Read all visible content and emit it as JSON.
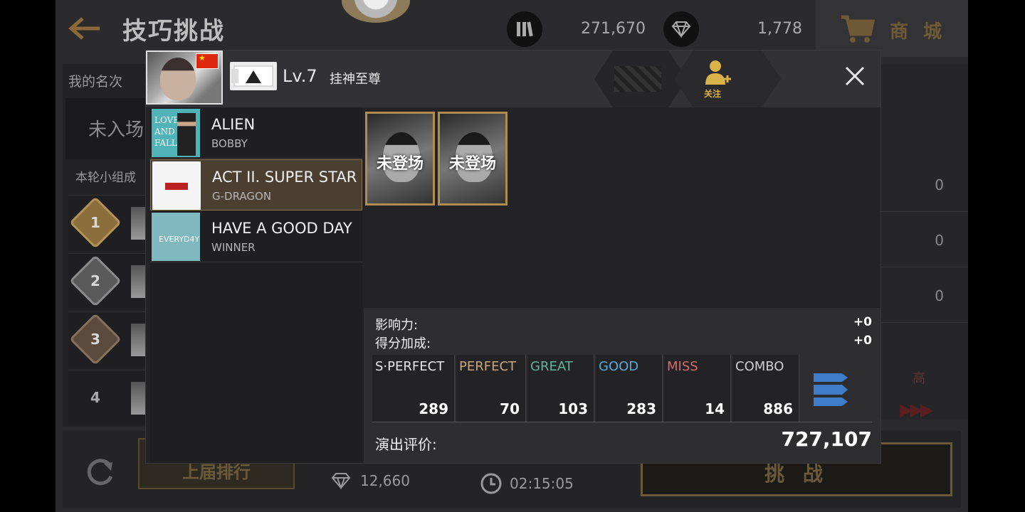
{
  "header": {
    "title": "技巧挑战",
    "currency1_value": "271,670",
    "currency2_value": "1,778",
    "shop_label": "商 城"
  },
  "ranking": {
    "my_rank_label": "我的名次",
    "my_rank_value": "未入场",
    "group_label": "本轮小组成",
    "rows": [
      {
        "rank": "1",
        "medal": "gold"
      },
      {
        "rank": "2",
        "medal": "silver"
      },
      {
        "rank": "3",
        "medal": "bronze"
      },
      {
        "rank": "4",
        "medal": "none"
      }
    ],
    "right_values": [
      "0",
      "0",
      "0"
    ]
  },
  "speed": {
    "label": "高",
    "arrows": "▶▶▶"
  },
  "bottom": {
    "last_rank_label": "上届排行",
    "prize_value": "12,660",
    "timer_value": "02:15:05",
    "challenge_label": "挑 战"
  },
  "modal": {
    "level": "Lv.7",
    "title": "挂神至尊",
    "follow_label": "关注",
    "songs": [
      {
        "title": "ALIEN",
        "artist": "BOBBY",
        "cover_text": "LOVE AND FALL",
        "selected": false
      },
      {
        "title": "ACT II. SUPER STAR",
        "artist": "G-DRAGON",
        "cover_text": "",
        "selected": true
      },
      {
        "title": "HAVE A GOOD DAY",
        "artist": "WINNER",
        "cover_text": "EVERYD4Y",
        "selected": false
      }
    ],
    "cards": [
      {
        "label": "未登场"
      },
      {
        "label": "未登场"
      }
    ],
    "influence_label": "影响力:",
    "influence_value": "+0",
    "score_bonus_label": "得分加成:",
    "score_bonus_value": "+0",
    "judgements": [
      {
        "name": "S·PERFECT",
        "value": "289",
        "color": "#e8e8e8"
      },
      {
        "name": "PERFECT",
        "value": "70",
        "color": "#c9a77a"
      },
      {
        "name": "GREAT",
        "value": "103",
        "color": "#5fb59a"
      },
      {
        "name": "GOOD",
        "value": "283",
        "color": "#5aa8d8"
      },
      {
        "name": "MISS",
        "value": "14",
        "color": "#d86a6a"
      },
      {
        "name": "COMBO",
        "value": "886",
        "color": "#cfcfcf"
      }
    ],
    "performance_label": "演出评价:",
    "performance_value": "727,107"
  }
}
